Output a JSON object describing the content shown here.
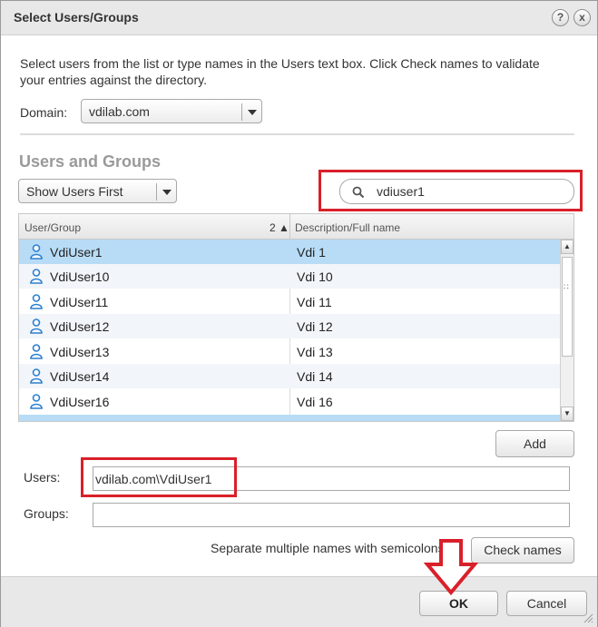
{
  "window": {
    "title": "Select Users/Groups",
    "help_icon": "?",
    "close_icon": "x"
  },
  "instruction": "Select users from the list or type names in the Users text box. Click Check names to validate your entries against the directory.",
  "domain": {
    "label": "Domain:",
    "value": "vdilab.com"
  },
  "section_title": "Users and Groups",
  "filter": {
    "value": "Show Users First"
  },
  "search": {
    "value": "vdiuser1",
    "icon": "search-icon"
  },
  "table": {
    "col1": "User/Group",
    "col2": "Description/Full name",
    "sort_indicator": "2 ▲",
    "rows": [
      {
        "name": "VdiUser1",
        "desc": "Vdi 1"
      },
      {
        "name": "VdiUser10",
        "desc": "Vdi 10"
      },
      {
        "name": "VdiUser11",
        "desc": "Vdi 11"
      },
      {
        "name": "VdiUser12",
        "desc": "Vdi 12"
      },
      {
        "name": "VdiUser13",
        "desc": "Vdi 13"
      },
      {
        "name": "VdiUser14",
        "desc": "Vdi 14"
      },
      {
        "name": "VdiUser16",
        "desc": "Vdi 16"
      }
    ]
  },
  "add_button": "Add",
  "users": {
    "label": "Users:",
    "value": "vdilab.com\\VdiUser1"
  },
  "groups": {
    "label": "Groups:",
    "value": ""
  },
  "hint": "Separate multiple names with semicolons",
  "check_names_button": "Check names",
  "ok_button": "OK",
  "cancel_button": "Cancel",
  "colors": {
    "highlight": "#d9202a",
    "selected_row": "#b8dcf6"
  }
}
